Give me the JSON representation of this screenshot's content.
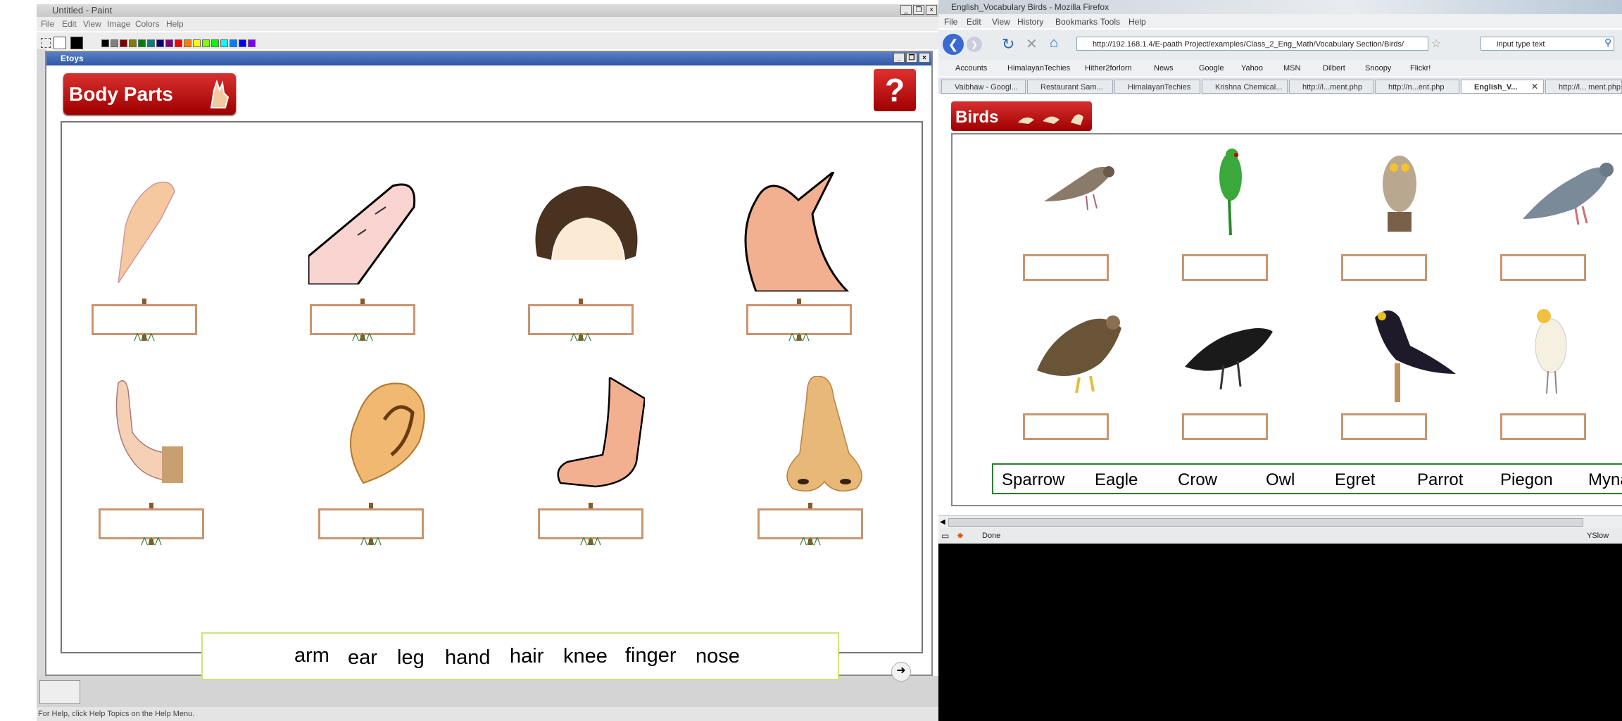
{
  "paint": {
    "title": "Untitled - Paint",
    "menu": [
      "File",
      "Edit",
      "View",
      "Image",
      "Colors",
      "Help"
    ],
    "status": "For Help, click Help Topics on the Help Menu.",
    "palette": [
      "#000000",
      "#808080",
      "#800000",
      "#808000",
      "#008000",
      "#008080",
      "#000080",
      "#800080",
      "#ff0000",
      "#ff8000",
      "#ffff00",
      "#80ff00",
      "#00ff00",
      "#00ffff",
      "#0080ff",
      "#0000ff",
      "#8000ff"
    ]
  },
  "etoys": {
    "title": "Etoys",
    "banner": "Body Parts",
    "help_label": "?",
    "words": [
      "arm",
      "ear",
      "leg",
      "hand",
      "hair",
      "knee",
      "finger",
      "nose"
    ],
    "pictures_row1": [
      "hand",
      "finger",
      "hair",
      "knee"
    ],
    "pictures_row2": [
      "arm",
      "ear",
      "leg",
      "nose"
    ]
  },
  "firefox": {
    "title": "English_Vocabulary Birds - Mozilla Firefox",
    "menu": [
      "File",
      "Edit",
      "View",
      "History",
      "Bookmarks",
      "Tools",
      "Help"
    ],
    "url": "http://192.168.1.4/E-paath Project/examples/Class_2_Eng_Math/Vocabulary Section/Birds/",
    "search_placeholder": "input type text",
    "bookmarks": [
      "Accounts",
      "HimalayanTechies",
      "Hither2forlorn",
      "News",
      "Google",
      "Yahoo",
      "MSN",
      "Dilbert",
      "Snoopy",
      "Flickr!"
    ],
    "tabs": [
      "Vaibhaw - Googl...",
      "Restaurant Sam...",
      "HimalayanTechies",
      "Krishna Chemical...",
      "http://l...ment.php",
      "http://n...ent.php",
      "English_V...",
      "http://l... ment.php"
    ],
    "active_tab": "English_V...",
    "banner": "Birds",
    "bird_words": [
      "Sparrow",
      "Eagle",
      "Crow",
      "Owl",
      "Egret",
      "Parrot",
      "Piegon",
      "Myna"
    ],
    "status": "Done",
    "status_right": "YSlow"
  }
}
